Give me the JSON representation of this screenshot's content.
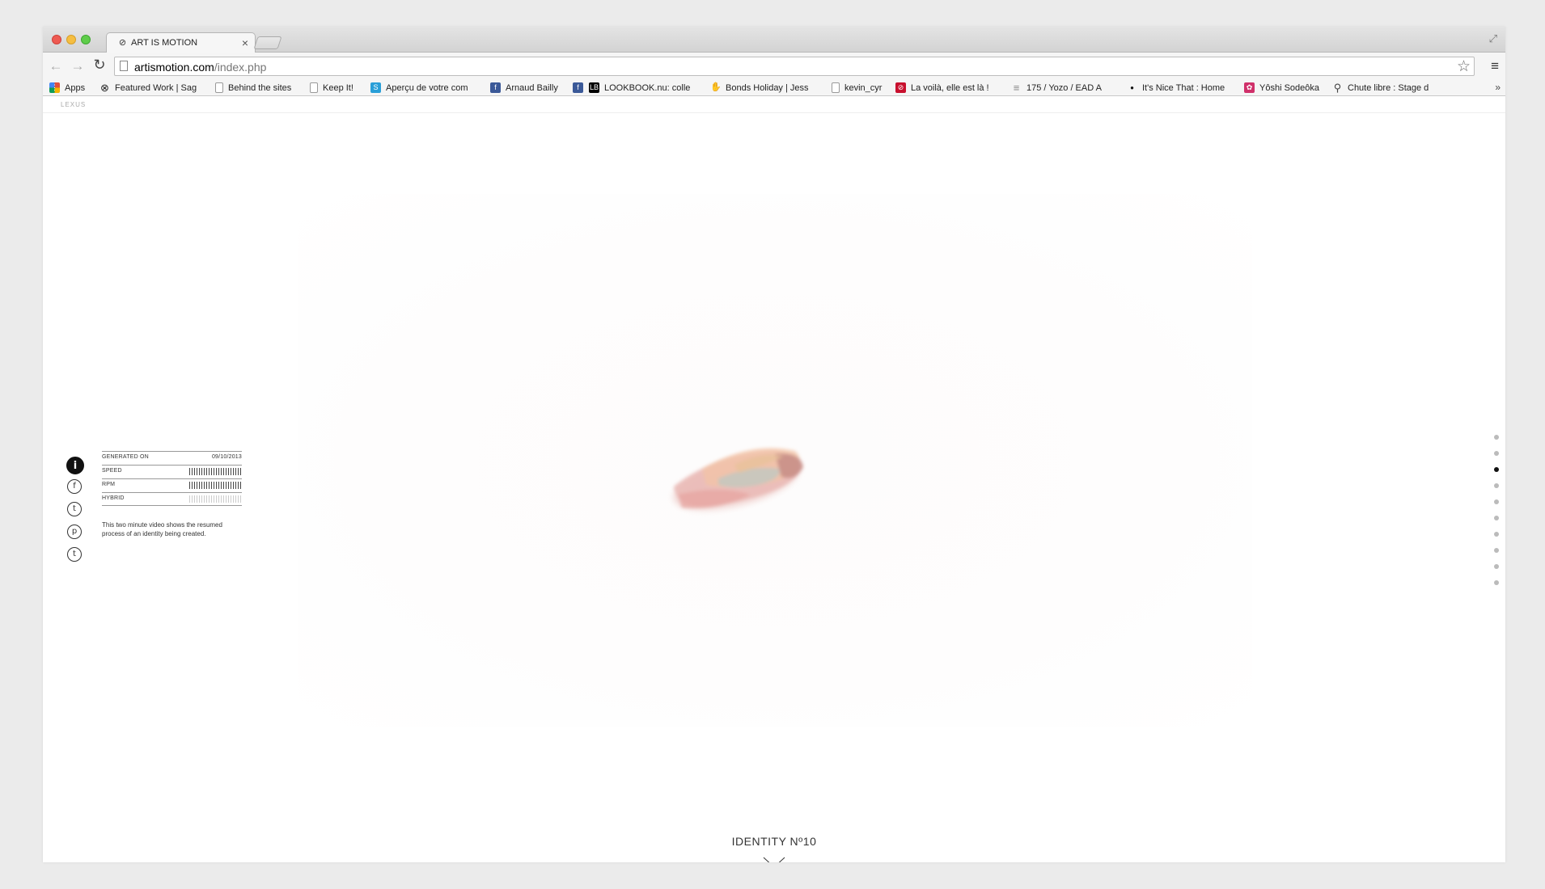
{
  "browser": {
    "tab_title": "ART IS MOTION",
    "tab_close": "×",
    "url_host": "artismotion.com",
    "url_path": "/index.php"
  },
  "bookmarks": [
    {
      "label": "Apps",
      "icon": "apps-grid-icon",
      "color": "#e0503c"
    },
    {
      "label": "Featured Work | Sag",
      "icon": "circle-logo-icon",
      "color": "#222222",
      "fade": "..."
    },
    {
      "label": "Behind the sites",
      "icon": "page-icon",
      "color": "#ffffff"
    },
    {
      "label": "Keep It!",
      "icon": "page-icon",
      "color": "#ffffff"
    },
    {
      "label": "Aperçu de votre com",
      "icon": "skype-icon",
      "color": "#2a9fd8"
    },
    {
      "label": "Arnaud Bailly",
      "icon": "facebook-icon",
      "color": "#3b5998"
    },
    {
      "label": "",
      "icon": "facebook-icon",
      "color": "#3b5998"
    },
    {
      "label": "LOOKBOOK.nu: colle",
      "icon": "lookbook-icon",
      "color": "#000000"
    },
    {
      "label": "Bonds Holiday | Jess",
      "icon": "hand-icon",
      "color": "#f0a020"
    },
    {
      "label": "kevin_cyr",
      "icon": "page-icon",
      "color": "#ffffff"
    },
    {
      "label": "La voilà, elle est là !",
      "icon": "red-circle-icon",
      "color": "#c8102e"
    },
    {
      "label": "175 / Yozo / EAD A",
      "icon": "stripes-icon",
      "color": "#888888"
    },
    {
      "label": "It's Nice That : Home",
      "icon": "dot-icon",
      "color": "#111111"
    },
    {
      "label": "Yôshi Sodeôka",
      "icon": "pink-square-icon",
      "color": "#d0306a"
    },
    {
      "label": "Chute libre : Stage d",
      "icon": "search-person-icon",
      "color": "#444444"
    }
  ],
  "page": {
    "brand": "LEXUS",
    "info_button": "i",
    "share_icons": [
      {
        "name": "facebook-share-icon",
        "glyph": "f"
      },
      {
        "name": "twitter-share-icon",
        "glyph": "t"
      },
      {
        "name": "pinterest-share-icon",
        "glyph": "p"
      },
      {
        "name": "tumblr-share-icon",
        "glyph": "t"
      }
    ],
    "info": {
      "generated_label": "GENERATED ON",
      "generated_value": "09/10/2013",
      "speed_label": "SPEED",
      "speed_level": 1.0,
      "rpm_label": "RPM",
      "rpm_level": 1.0,
      "hybrid_label": "HYBRID",
      "hybrid_level": 0.0
    },
    "description": "This two minute video shows the resumed process of an identity being created.",
    "identity_title": "IDENTITY Nº10",
    "dot_count": 10,
    "active_dot": 2
  }
}
